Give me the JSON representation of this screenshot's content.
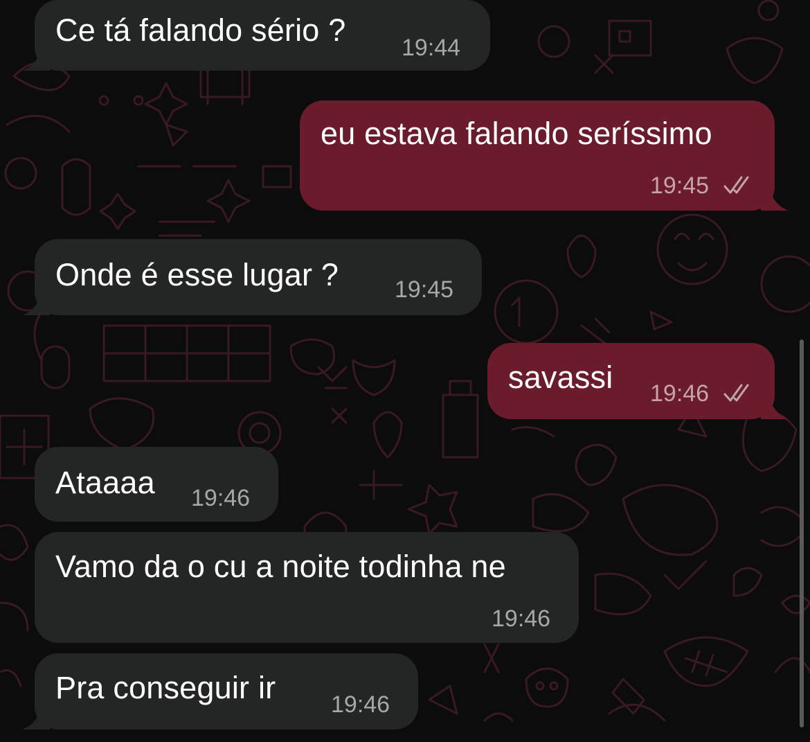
{
  "colors": {
    "background": "#0c0c0c",
    "incoming_bubble": "#242626",
    "outgoing_bubble": "#6a1c2d",
    "text": "#ffffff",
    "timestamp": "#a7a7a7",
    "wallpaper_doodle": "#3a1a22"
  },
  "messages": [
    {
      "direction": "incoming",
      "text": "Ce tá falando sério ?",
      "time": "19:44"
    },
    {
      "direction": "outgoing",
      "text": "eu estava falando seríssimo",
      "time": "19:45",
      "status_icon": "double-check-icon",
      "status": "read"
    },
    {
      "direction": "incoming",
      "text": "Onde é esse lugar ?",
      "time": "19:45"
    },
    {
      "direction": "outgoing",
      "text": "savassi",
      "time": "19:46",
      "status_icon": "double-check-icon",
      "status": "read"
    },
    {
      "direction": "incoming",
      "text": "Ataaaa",
      "time": "19:46"
    },
    {
      "direction": "incoming",
      "text": "Vamo da o cu a noite todinha ne",
      "time": "19:46"
    },
    {
      "direction": "incoming",
      "text": "Pra conseguir ir",
      "time": "19:46"
    }
  ]
}
